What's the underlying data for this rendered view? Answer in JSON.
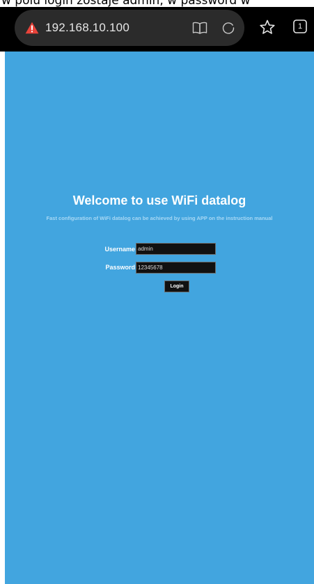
{
  "caption": "w polu login zostaje admin, w password w",
  "browser": {
    "url": "192.168.10.100",
    "tab_count": "1"
  },
  "page": {
    "title": "Welcome to use WiFi datalog",
    "subtitle": "Fast configuration of WiFi datalog can be achieved by using APP on the instruction manual",
    "background_color": "#42a5df",
    "form": {
      "username_label": "Username",
      "username_value": "admin",
      "password_label": "Password",
      "password_value": "12345678",
      "login_label": "Login"
    }
  },
  "icons": {
    "security_warning": "warning-icon",
    "reader_mode": "book-icon",
    "reload": "reload-icon",
    "bookmark": "star-icon",
    "tabs": "tabs-icon"
  }
}
